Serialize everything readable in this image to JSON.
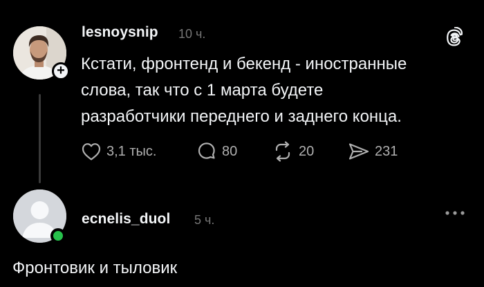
{
  "post": {
    "username": "lesnoysnip",
    "time": "10 ч.",
    "text": "Кстати, фронтенд и бекенд - иностранные\nслова, так что с 1 марта будете\nразработчики переднего и заднего конца.",
    "likes": "3,1 тыс.",
    "comments": "80",
    "reposts": "20",
    "shares": "231",
    "follow_badge": "+"
  },
  "reply": {
    "username": "ecnelis_duol",
    "time": "5 ч.",
    "text": "Фронтовик и тыловик",
    "status_color": "#27c24c"
  },
  "icons": {
    "post": [
      "threads-logo-icon",
      "heart-icon",
      "comment-icon",
      "repost-icon",
      "share-icon"
    ],
    "reply": [
      "more-options-icon"
    ]
  }
}
